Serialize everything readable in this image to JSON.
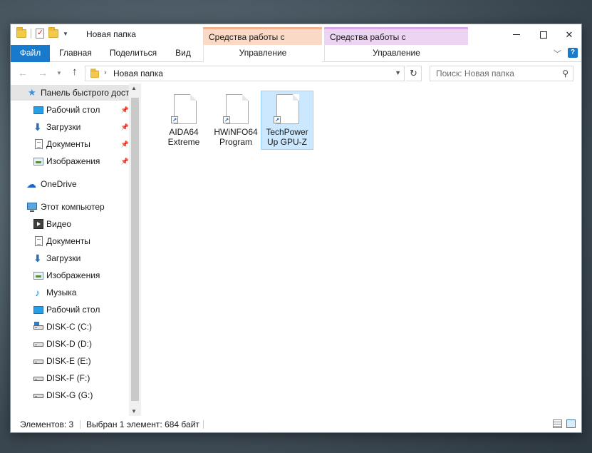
{
  "window": {
    "title": "Новая папка",
    "ctx_tab_shortcuts": "Средства работы с ярлыками",
    "ctx_tab_apps": "Средства работы с приложениями"
  },
  "ribbon": {
    "file": "Файл",
    "home": "Главная",
    "share": "Поделиться",
    "view": "Вид",
    "manage_shortcuts": "Управление",
    "manage_apps": "Управление",
    "help": "?"
  },
  "address": {
    "path": "Новая папка",
    "search_placeholder": "Поиск: Новая папка"
  },
  "nav": {
    "quick_access": "Панель быстрого доступа",
    "quick_items": [
      {
        "label": "Рабочий стол",
        "icon": "desktop-icon"
      },
      {
        "label": "Загрузки",
        "icon": "downloads-icon"
      },
      {
        "label": "Документы",
        "icon": "documents-icon"
      },
      {
        "label": "Изображения",
        "icon": "pictures-icon"
      }
    ],
    "onedrive": "OneDrive",
    "this_pc": "Этот компьютер",
    "pc_items": [
      {
        "label": "Видео",
        "icon": "video-icon"
      },
      {
        "label": "Документы",
        "icon": "documents-icon"
      },
      {
        "label": "Загрузки",
        "icon": "downloads-icon"
      },
      {
        "label": "Изображения",
        "icon": "pictures-icon"
      },
      {
        "label": "Музыка",
        "icon": "music-icon"
      },
      {
        "label": "Рабочий стол",
        "icon": "desktop-icon"
      },
      {
        "label": "DISK-C (C:)",
        "icon": "system-drive-icon"
      },
      {
        "label": "DISK-D (D:)",
        "icon": "drive-icon"
      },
      {
        "label": "DISK-E (E:)",
        "icon": "drive-icon"
      },
      {
        "label": "DISK-F (F:)",
        "icon": "drive-icon"
      },
      {
        "label": "DISK-G (G:)",
        "icon": "drive-icon"
      }
    ]
  },
  "files": [
    {
      "name": "AIDA64\nExtreme",
      "selected": false
    },
    {
      "name": "HWiNFO64\nProgram",
      "selected": false
    },
    {
      "name": "TechPower\nUp GPU-Z",
      "selected": true
    }
  ],
  "status": {
    "count": "Элементов: 3",
    "selection": "Выбран 1 элемент: 684 байт"
  },
  "colors": {
    "accent": "#1979ca",
    "selection": "#cce8ff",
    "ctx_orange": "#fbd9c7",
    "ctx_purple": "#ecd4f2"
  }
}
